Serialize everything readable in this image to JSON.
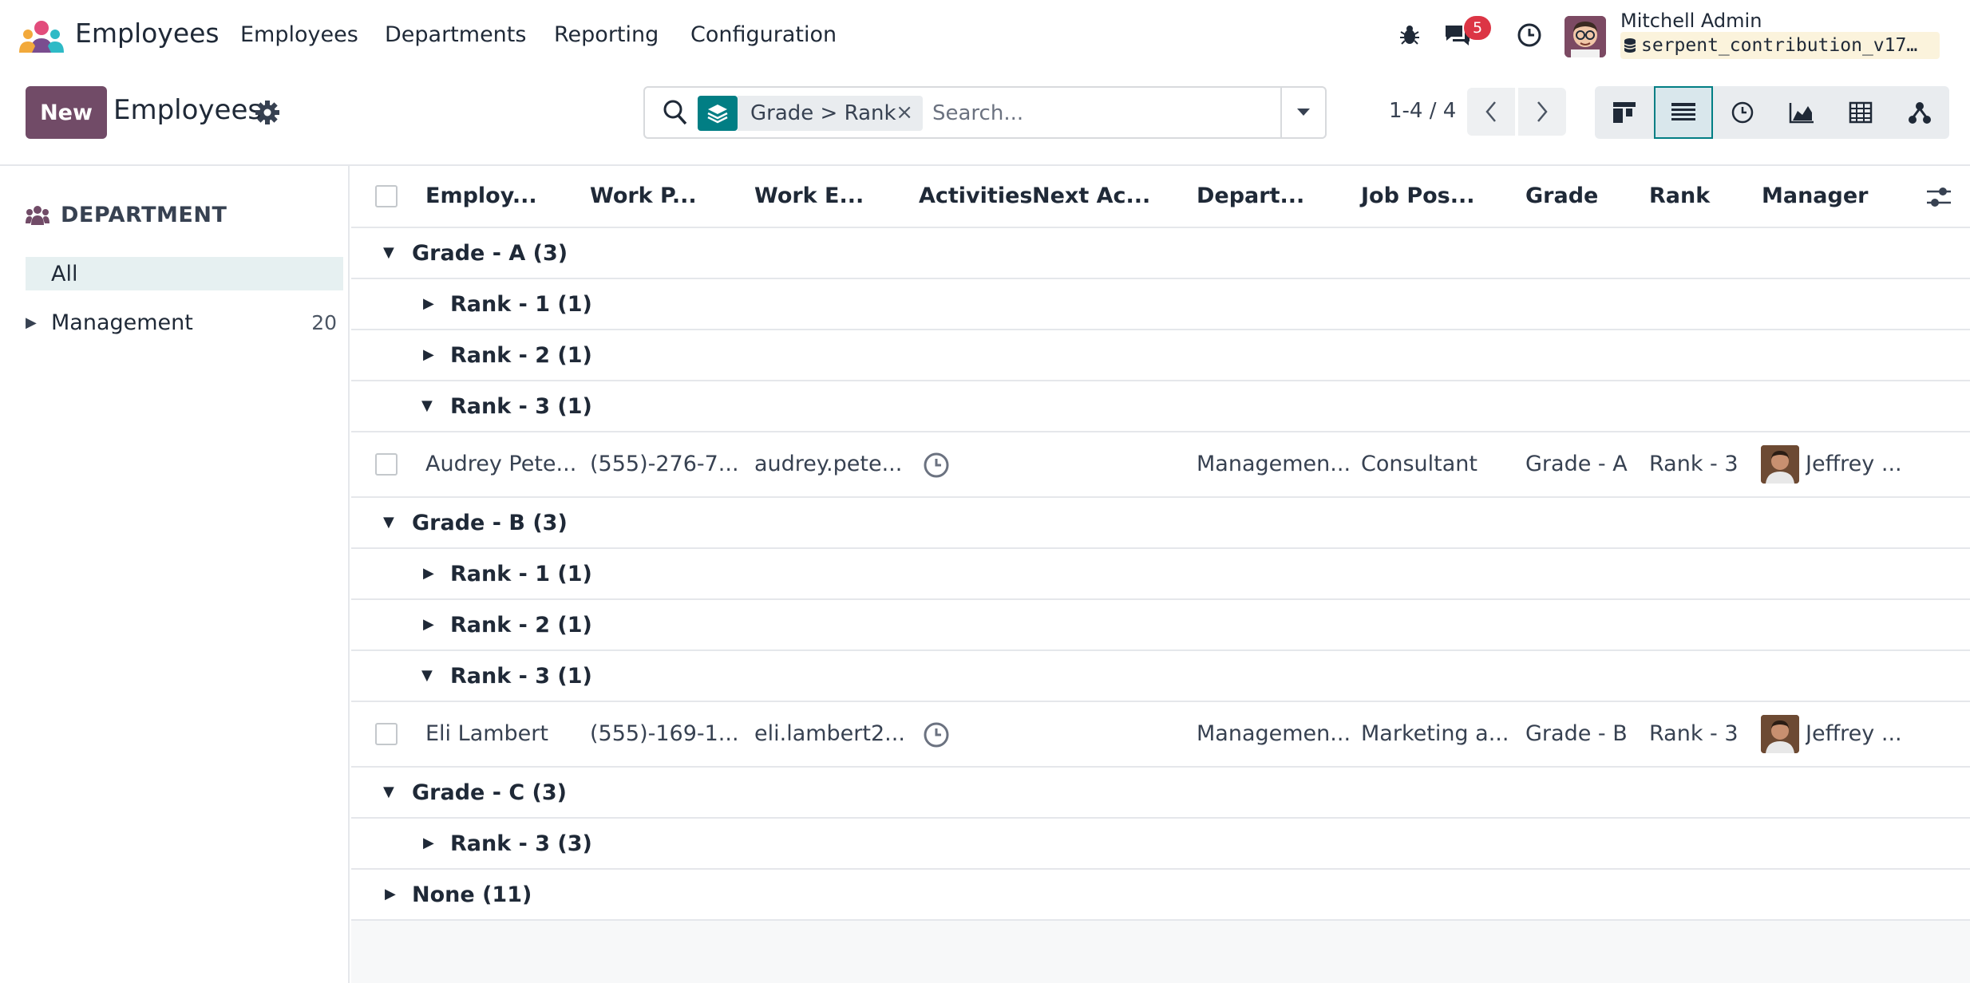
{
  "navbar": {
    "app_name": "Employees",
    "menu": [
      "Employees",
      "Departments",
      "Reporting",
      "Configuration"
    ],
    "messages_badge": "5",
    "user_name": "Mitchell Admin",
    "database": "serpent_contribution_v17…"
  },
  "control": {
    "new_label": "New",
    "breadcrumb": "Employees",
    "facet_label": "Grade > Rank",
    "facet_remove": "×",
    "search_placeholder": "Search...",
    "pager": "1-4 / 4",
    "views": [
      "kanban",
      "list",
      "activity",
      "graph",
      "pivot",
      "hierarchy"
    ],
    "active_view": "list"
  },
  "sidebar": {
    "title": "DEPARTMENT",
    "all_label": "All",
    "items": [
      {
        "label": "Management",
        "count": "20"
      }
    ]
  },
  "table": {
    "headers": [
      "Employ...",
      "Work P...",
      "Work E...",
      "Activities",
      "Next Ac...",
      "Depart...",
      "Job Pos...",
      "Grade",
      "Rank",
      "Manager"
    ],
    "groups": {
      "g_a": "Grade - A (3)",
      "g_a_r1": "Rank - 1 (1)",
      "g_a_r2": "Rank - 2 (1)",
      "g_a_r3": "Rank - 3 (1)",
      "g_b": "Grade - B (3)",
      "g_b_r1": "Rank - 1 (1)",
      "g_b_r2": "Rank - 2 (1)",
      "g_b_r3": "Rank - 3 (1)",
      "g_c": "Grade - C (3)",
      "g_c_r3": "Rank - 3 (3)",
      "none": "None (11)"
    },
    "rows": [
      {
        "name": "Audrey Pete...",
        "phone": "(555)-276-7...",
        "email": "audrey.pete...",
        "department": "Managemen...",
        "job": "Consultant",
        "grade": "Grade - A",
        "rank": "Rank - 3",
        "manager": "Jeffrey ..."
      },
      {
        "name": "Eli Lambert",
        "phone": "(555)-169-1...",
        "email": "eli.lambert2...",
        "department": "Managemen...",
        "job": "Marketing a...",
        "grade": "Grade - B",
        "rank": "Rank - 3",
        "manager": "Jeffrey ..."
      }
    ]
  },
  "colors": {
    "primary": "#714b67",
    "accent": "#017e84",
    "badge": "#dc3545"
  }
}
